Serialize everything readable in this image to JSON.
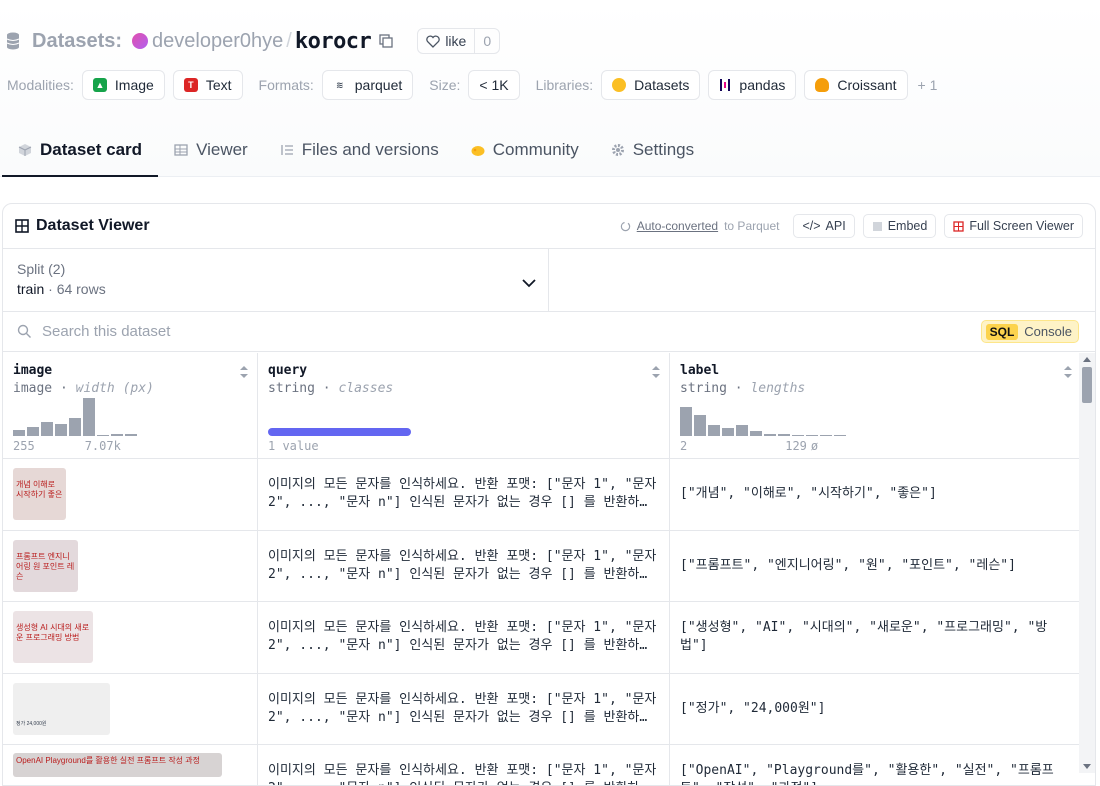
{
  "header": {
    "section": "Datasets:",
    "org": "developer0hye",
    "repo": "korocr",
    "like_label": "like",
    "like_count": "0"
  },
  "tags": {
    "modalities_label": "Modalities:",
    "modalities": [
      "Image",
      "Text"
    ],
    "formats_label": "Formats:",
    "formats": [
      "parquet"
    ],
    "size_label": "Size:",
    "size": "< 1K",
    "libraries_label": "Libraries:",
    "libraries": [
      "Datasets",
      "pandas",
      "Croissant"
    ],
    "more": "+ 1"
  },
  "tabs": [
    "Dataset card",
    "Viewer",
    "Files and versions",
    "Community",
    "Settings"
  ],
  "viewer": {
    "title": "Dataset Viewer",
    "auto_link": "Auto-converted",
    "auto_suffix": "to Parquet",
    "api": "API",
    "embed": "Embed",
    "fullscreen": "Full Screen Viewer",
    "split_label": "Split (2)",
    "split_name": "train",
    "split_rows": "64 rows",
    "search_placeholder": "Search this dataset",
    "sql_badge": "SQL",
    "sql_label": "Console"
  },
  "columns": [
    {
      "name": "image",
      "type": "image",
      "stat": "width (px)",
      "axis_min": "255",
      "axis_max": "7.07k",
      "hist": [
        0.15,
        0.22,
        0.35,
        0.3,
        0.45,
        0.95,
        0.0,
        0.05,
        0.05
      ]
    },
    {
      "name": "query",
      "type": "string",
      "stat": "classes",
      "value_count": "1 value"
    },
    {
      "name": "label",
      "type": "string",
      "stat": "lengths",
      "axis_min": "2",
      "axis_max": "129",
      "hist": [
        0.95,
        0.7,
        0.35,
        0.25,
        0.35,
        0.15,
        0.08,
        0.05,
        0.03,
        0.02,
        0.02,
        0.01
      ]
    }
  ],
  "rows": [
    {
      "thumb_text": "개념 이해로 시작하기 좋은",
      "query": "이미지의 모든 문자를 인식하세요. 반환 포맷: [\"문자 1\", \"문자 2\", ..., \"문자 n\"] 인식된 문자가 없는 경우 [] 를 반환하세요.",
      "label": "[\"개념\", \"이해로\", \"시작하기\", \"좋은\"]"
    },
    {
      "thumb_text": "프롬프트 엔지니어링 원 포인트 레슨",
      "query": "이미지의 모든 문자를 인식하세요. 반환 포맷: [\"문자 1\", \"문자 2\", ..., \"문자 n\"] 인식된 문자가 없는 경우 [] 를 반환하세요.",
      "label": "[\"프롬프트\", \"엔지니어링\", \"원\", \"포인트\", \"레슨\"]"
    },
    {
      "thumb_text": "생성형 AI 시대의 새로운 프로그래밍 방법",
      "query": "이미지의 모든 문자를 인식하세요. 반환 포맷: [\"문자 1\", \"문자 2\", ..., \"문자 n\"] 인식된 문자가 없는 경우 [] 를 반환하세요.",
      "label": "[\"생성형\", \"AI\", \"시대의\", \"새로운\", \"프로그래밍\", \"방법\"]"
    },
    {
      "thumb_text": "정가 24,000원",
      "query": "이미지의 모든 문자를 인식하세요. 반환 포맷: [\"문자 1\", \"문자 2\", ..., \"문자 n\"] 인식된 문자가 없는 경우 [] 를 반환하세요.",
      "label": "[\"정가\", \"24,000원\"]"
    },
    {
      "thumb_text": "OpenAI Playground를 활용한 실전 프롬프트 작성 과정",
      "query": "이미지의 모든 문자를 인식하세요. 반환 포맷: [\"문자 1\", \"문자 2\", ..., \"문자 n\"] 인식된 문자가 없는 경우 [] 를 반환하세요.",
      "label": "[\"OpenAI\", \"Playground를\", \"활용한\", \"실전\", \"프롬프트\", \"작성\", \"과정\"]"
    }
  ]
}
